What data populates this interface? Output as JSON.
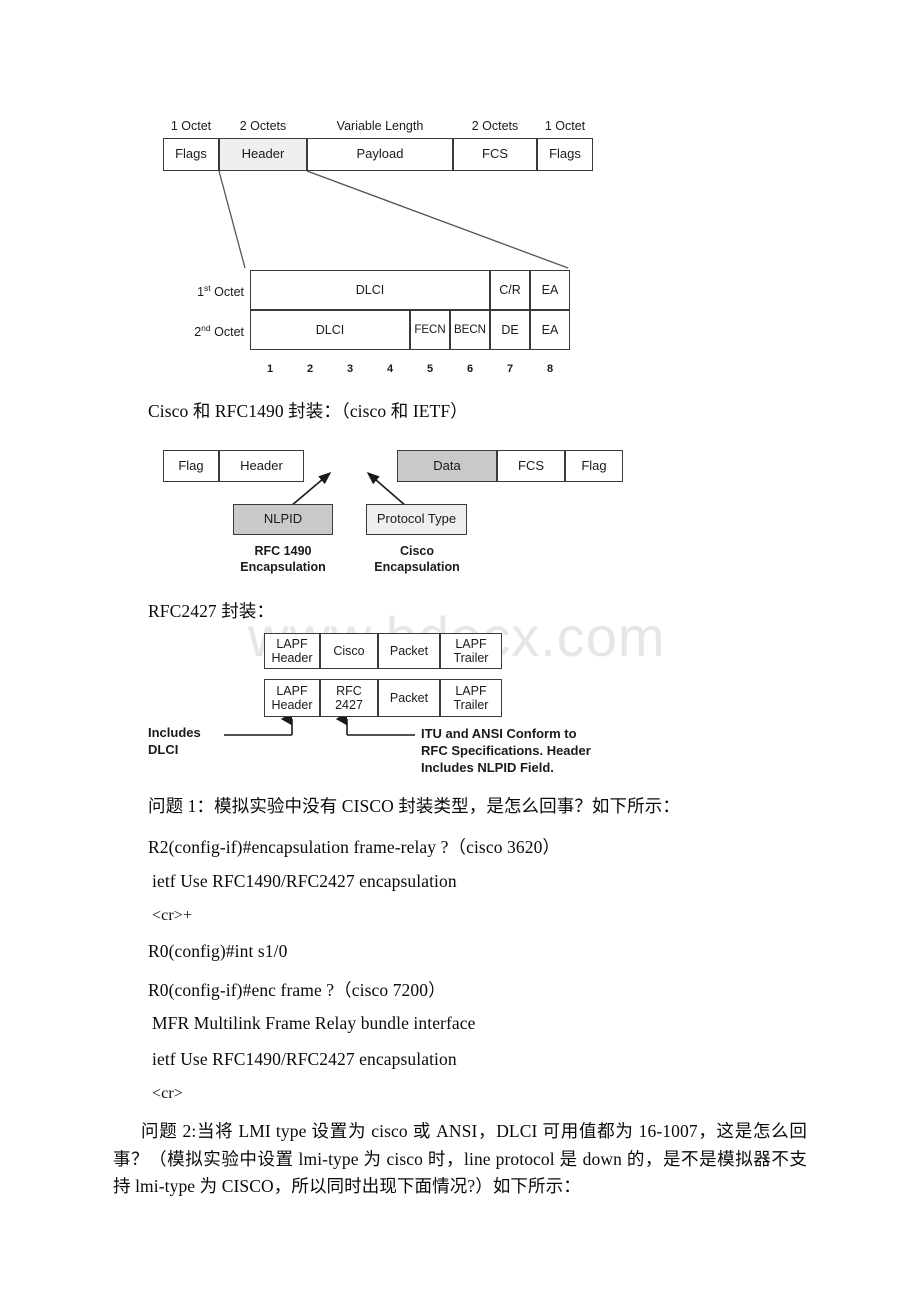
{
  "document": {
    "watermark": "www.bdocx.com"
  },
  "fr_frame_diagram": {
    "name": "Frame Relay frame format",
    "length_labels": [
      "1 Octet",
      "2 Octets",
      "Variable Length",
      "2 Octets",
      "1 Octet"
    ],
    "fields": [
      "Flags",
      "Header",
      "Payload",
      "FCS",
      "Flags"
    ]
  },
  "dlci_diagram": {
    "name": "Frame Relay header octets",
    "row_labels": [
      "1st Octet",
      "2nd Octet"
    ],
    "row_label_sup": [
      "st",
      "nd"
    ],
    "row_label_base": [
      "1",
      "2"
    ],
    "row1_fields": [
      "DLCI",
      "C/R",
      "EA"
    ],
    "row2_fields": [
      "DLCI",
      "FECN",
      "BECN",
      "DE",
      "EA"
    ],
    "bit_numbers": [
      "1",
      "2",
      "3",
      "4",
      "5",
      "6",
      "7",
      "8"
    ]
  },
  "heading_encap": "Cisco 和 RFC1490 封装：（cisco 和 IETF）",
  "encap_diagram": {
    "name": "Cisco vs RFC1490 encapsulation",
    "left_boxes": [
      "Flag",
      "Header"
    ],
    "right_boxes": [
      "Data",
      "FCS",
      "Flag"
    ],
    "callout_left": "NLPID",
    "callout_right": "Protocol Type",
    "caption_left_line1": "RFC 1490",
    "caption_left_line2": "Encapsulation",
    "caption_right_line1": "Cisco",
    "caption_right_line2": "Encapsulation"
  },
  "heading_rfc2427": "RFC2427 封装：",
  "rfc2427_diagram": {
    "name": "RFC2427 encapsulation comparison",
    "row1": [
      {
        "line1": "LAPF",
        "line2": "Header"
      },
      {
        "line1": "Cisco",
        "line2": ""
      },
      {
        "line1": "Packet",
        "line2": ""
      },
      {
        "line1": "LAPF",
        "line2": "Trailer"
      }
    ],
    "row2": [
      {
        "line1": "LAPF",
        "line2": "Header"
      },
      {
        "line1": "RFC",
        "line2": "2427"
      },
      {
        "line1": "Packet",
        "line2": ""
      },
      {
        "line1": "LAPF",
        "line2": "Trailer"
      }
    ],
    "annotation_left_line1": "Includes",
    "annotation_left_line2": "DLCI",
    "annotation_right_line1": "ITU and ANSI Conform to",
    "annotation_right_line2": "RFC Specifications. Header",
    "annotation_right_line3": "Includes NLPID Field."
  },
  "body": {
    "q1_heading": "问题 1：模拟实验中没有 CISCO 封装类型，是怎么回事？如下所示：",
    "line_r2_encap": "R2(config-if)#encapsulation frame-relay ?（cisco 3620）",
    "line_ietf_1": "ietf Use RFC1490/RFC2427 encapsulation",
    "line_cr_plus": "<cr>+",
    "line_r0_int": "R0(config)#int s1/0",
    "line_r0_enc": "R0(config-if)#enc frame ?（cisco 7200）",
    "line_mfr": "MFR Multilink Frame Relay bundle interface",
    "line_ietf_2": "ietf Use RFC1490/RFC2427 encapsulation",
    "line_cr": "<cr>",
    "q2_paragraph": "问题 2:当将 LMI type 设置为 cisco 或 ANSI，DLCI 可用值都为 16-1007，这是怎么回事？（模拟实验中设置 lmi-type 为 cisco 时，line protocol 是 down 的，是不是模拟器不支持 lmi-type 为 CISCO，所以同时出现下面情况?）如下所示："
  }
}
